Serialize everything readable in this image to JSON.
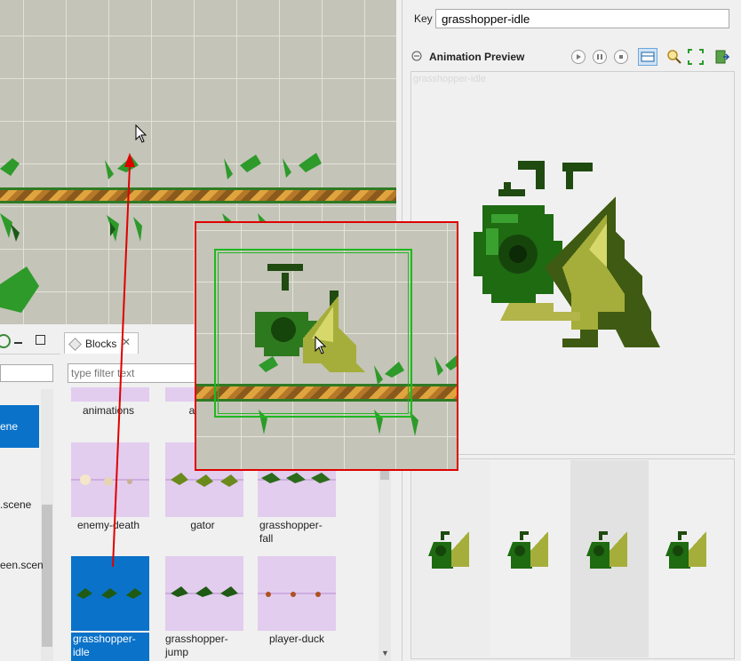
{
  "properties": {
    "key_label": "Key",
    "key_value": "grasshopper-idle"
  },
  "animation_preview": {
    "title": "Animation Preview",
    "watermark": "grasshopper-idle",
    "frame_count": 4
  },
  "blocks_view": {
    "tab_label": "Blocks",
    "filter_placeholder": "type filter text",
    "items": [
      {
        "label": "animations"
      },
      {
        "label": "a"
      },
      {
        "label": "enemy-death"
      },
      {
        "label": "gator"
      },
      {
        "label": "grasshopper-fall"
      },
      {
        "label": "grasshopper-idle"
      },
      {
        "label": "grasshopper-jump"
      },
      {
        "label": "player-duck"
      }
    ]
  },
  "left_tree": {
    "items": [
      {
        "label": "ene"
      },
      {
        "label": ".scene"
      },
      {
        "label": "een.scen"
      }
    ]
  },
  "colors": {
    "selection": "#0a72c9",
    "block_bg": "#e2cdee",
    "highlight_frame": "#e00000",
    "selection_frame": "#1fb81f",
    "drag_arrow": "#e00000"
  }
}
